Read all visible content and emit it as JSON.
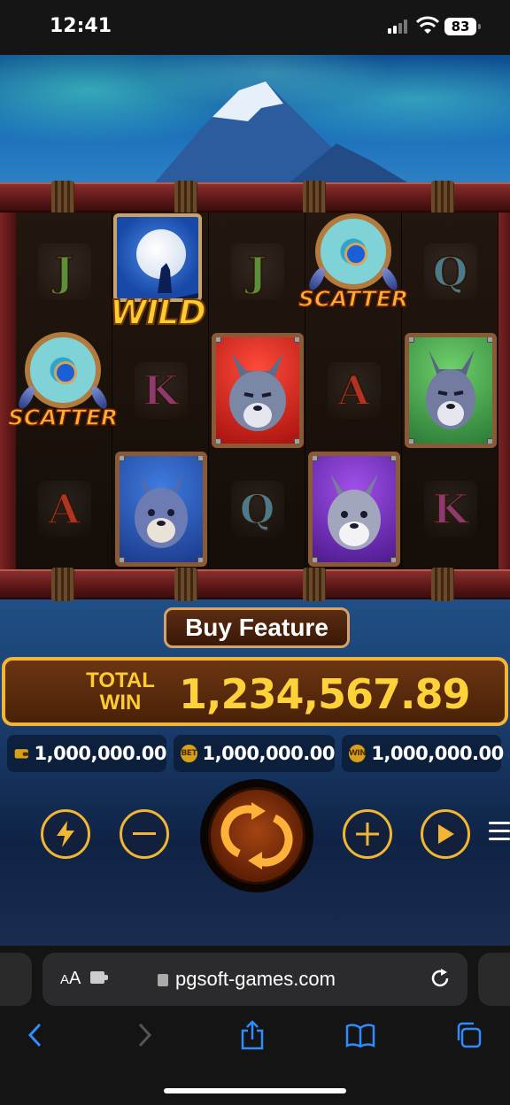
{
  "status_bar": {
    "time": "12:41",
    "battery": "83"
  },
  "reels": [
    [
      "J",
      "scatter",
      "A"
    ],
    [
      "wild",
      "K",
      "wolf-blue"
    ],
    [
      "J",
      "wolf-red",
      "Q"
    ],
    [
      "scatter",
      "A",
      "wolf-purple"
    ],
    [
      "Q",
      "wolf-green",
      "K"
    ]
  ],
  "symbols": {
    "wild_label": "WILD",
    "scatter_label": "SCATTER"
  },
  "buy_feature": {
    "label": "Buy Feature"
  },
  "total_win": {
    "label_line1": "TOTAL",
    "label_line2": "WIN",
    "value": "1,234,567.89"
  },
  "info": {
    "balance": {
      "icon": "wallet-icon",
      "value": "1,000,000.00"
    },
    "bet": {
      "icon": "bet-icon",
      "icon_text": "BET",
      "value": "1,000,000.00"
    },
    "win": {
      "icon": "win-icon",
      "icon_text": "WIN",
      "value": "1,000,000.00"
    }
  },
  "controls": [
    "turbo-lightning",
    "minus",
    "spin",
    "plus",
    "autoplay",
    "menu"
  ],
  "browser": {
    "aa_label": "A",
    "aa_big": "A",
    "url": "pgsoft-games.com"
  },
  "colors": {
    "gold": "#f2b632",
    "win_text": "#ffd23a",
    "panel_brown": "#4a2108",
    "frame_red": "#7d2424"
  }
}
